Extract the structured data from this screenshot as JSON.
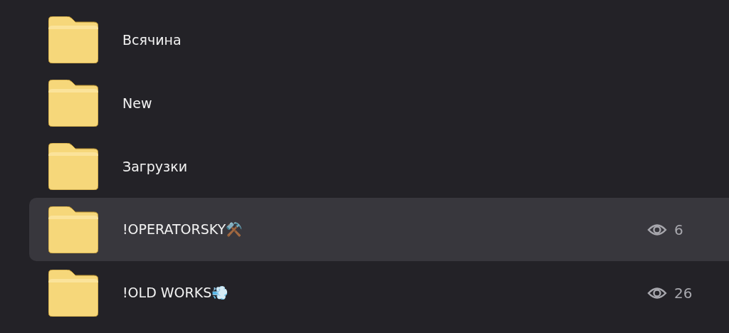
{
  "folders": [
    {
      "name": "Всячина",
      "selected": false
    },
    {
      "name": "New",
      "selected": false
    },
    {
      "name": "Загрузки",
      "selected": false
    },
    {
      "name": "!OPERATORSKY⚒️",
      "selected": true,
      "views": "6"
    },
    {
      "name": "!OLD WORKS💨",
      "selected": false,
      "views": "26"
    }
  ]
}
